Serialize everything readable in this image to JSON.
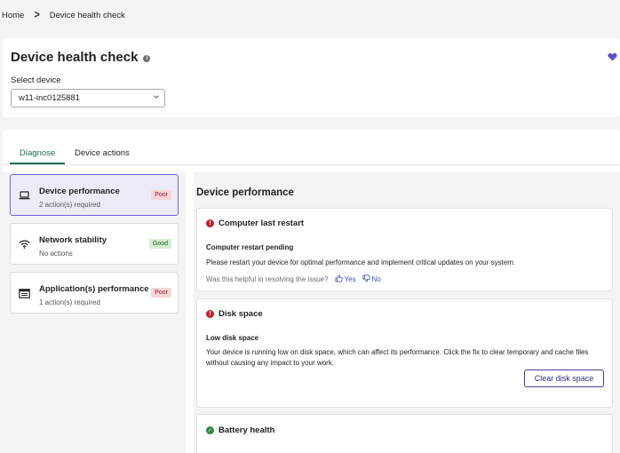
{
  "breadcrumb": {
    "home": "Home",
    "separator": ">",
    "current": "Device health check"
  },
  "header": {
    "title": "Device health check",
    "info_glyph": "i",
    "select_label": "Select device",
    "selected_device": "w11-inc0125881"
  },
  "tabs": [
    {
      "label": "Diagnose",
      "active": true
    },
    {
      "label": "Device actions",
      "active": false
    }
  ],
  "categories": [
    {
      "name": "Device performance",
      "sub": "2 action(s) required",
      "badge": "Poor",
      "icon": "laptop-icon",
      "selected": true
    },
    {
      "name": "Network stability",
      "sub": "No actions",
      "badge": "Good",
      "icon": "wifi-icon",
      "selected": false
    },
    {
      "name": "Application(s) performance",
      "sub": "1 action(s) required",
      "badge": "Poor",
      "icon": "app-window-icon",
      "selected": false
    }
  ],
  "detail": {
    "title": "Device performance",
    "issues": [
      {
        "title": "Computer last restart",
        "status": "error",
        "subtitle": "Computer restart pending",
        "description": "Please restart your device for optimal performance and implement critical updates on your system.",
        "feedback_question": "Was this helpful in resolving the issue?",
        "feedback_yes": "Yes",
        "feedback_no": "No"
      },
      {
        "title": "Disk space",
        "status": "error",
        "subtitle": "Low disk space",
        "description": "Your device is running low on disk space, which can affect its performance. Click the fix to clear temporary and cache files without causing any impact to your work.",
        "action_label": "Clear disk space"
      },
      {
        "title": "Battery health",
        "status": "ok"
      }
    ]
  },
  "colors": {
    "accent_green": "#1d6f50",
    "selected_border": "#6e64d8",
    "error_red": "#c4212c",
    "ok_green": "#2f8a3f",
    "link_blue": "#3b4fbf",
    "heart": "#5a4fcf"
  }
}
